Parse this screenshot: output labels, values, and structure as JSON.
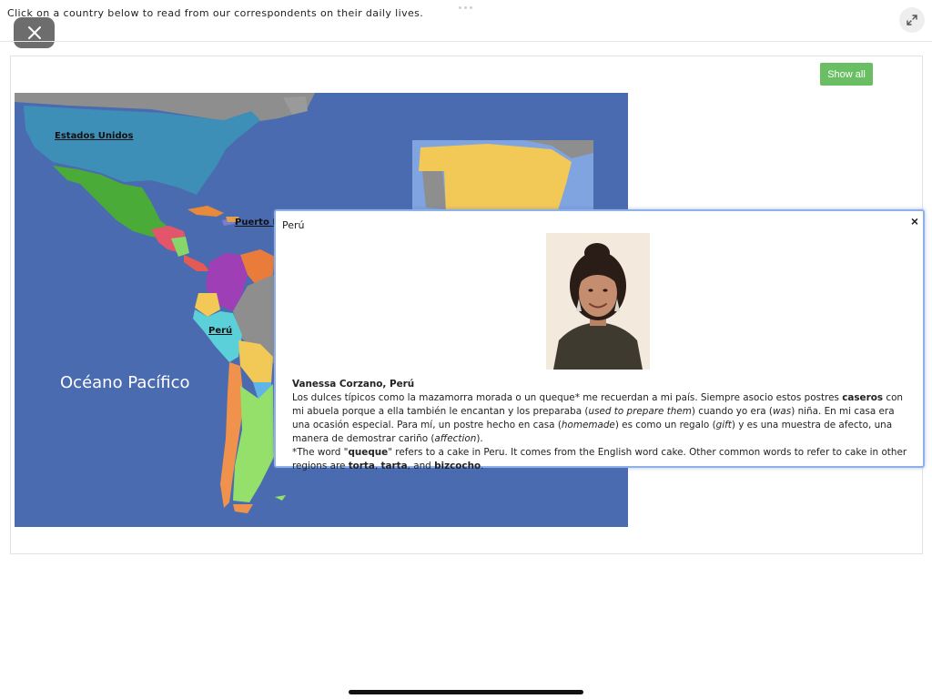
{
  "header": {
    "instruction": "Click on a country below to read from our correspondents on their daily lives."
  },
  "controls": {
    "close_icon": "close-icon",
    "expand_icon": "expand-icon",
    "show_all_label": "Show all",
    "show_all_color": "#6abf64"
  },
  "map": {
    "labels": {
      "usa": "Estados Unidos",
      "puerto_rico": "Puerto R",
      "peru": "Perú",
      "ocean": "Océano Pacífico"
    },
    "ocean_color": "#4a6bb0"
  },
  "popup": {
    "title": "Perú",
    "close_label": "×",
    "correspondent": "Vanessa Corzano, Perú",
    "p1": {
      "a": "Los dulces típicos como la mazamorra morada o un queque* me recuerdan a mi país. Siempre asocio estos postres ",
      "b": "caseros",
      "c": " con mi abuela porque a ella también le encantan y los preparaba (",
      "d": "used to prepare them",
      "e": ") cuando yo era (",
      "f": "was",
      "g": ") niña. En mi casa era una ocasión especial. Para mí, un postre hecho en casa (",
      "h": "homemade",
      "i": ") es como un regalo (",
      "j": "gift",
      "k": ") y es una muestra de afecto, una manera de demostrar cariño (",
      "l": "affection",
      "m": ")."
    },
    "p2": {
      "a": "*The word \"",
      "b": "queque",
      "c": "\" refers to a cake in Peru. It comes from the English word cake. Other common words to refer to cake in other regions are ",
      "d": "torta",
      "e": ", ",
      "f": "tarta",
      "g": ", and ",
      "h": "bizcocho",
      "i": "."
    }
  }
}
